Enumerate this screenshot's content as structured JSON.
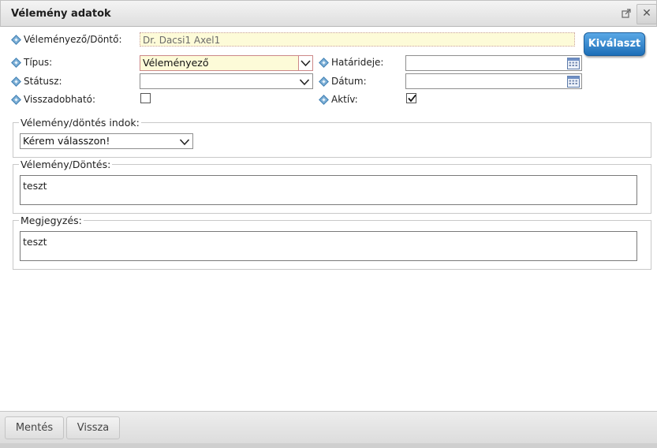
{
  "window": {
    "title": "Vélemény adatok",
    "popout_icon": "popout-icon",
    "close_icon": "close-icon",
    "close_label": "✕"
  },
  "form": {
    "opinion_giver": {
      "label": "Véleményező/Döntő:",
      "value": "Dr. Dacsi1 Axel1",
      "button_label": "Kiválaszt"
    },
    "type": {
      "label": "Típus:",
      "value": "Véleményező"
    },
    "deadline": {
      "label": "Határideje:",
      "value": ""
    },
    "status": {
      "label": "Státusz:",
      "value": ""
    },
    "date": {
      "label": "Dátum:",
      "value": ""
    },
    "withdrawable": {
      "label": "Visszadobható:",
      "checked": false
    },
    "active": {
      "label": "Aktív:",
      "checked": true
    }
  },
  "reason": {
    "legend": "Vélemény/döntés indok:",
    "value": "Kérem válasszon!"
  },
  "opinion": {
    "legend": "Vélemény/Döntés:",
    "value": "teszt"
  },
  "note": {
    "legend": "Megjegyzés:",
    "value": "teszt"
  },
  "footer": {
    "save_label": "Mentés",
    "back_label": "Vissza"
  },
  "colors": {
    "accent_button": "#1d6fb8",
    "readonly_bg": "#fdfbd8",
    "bullet": "#7fb0d6"
  }
}
